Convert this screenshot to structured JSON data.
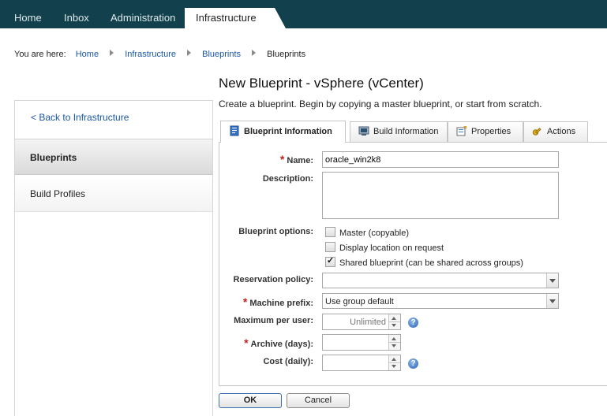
{
  "nav": {
    "tabs": [
      "Home",
      "Inbox",
      "Administration",
      "Infrastructure"
    ],
    "active": "Infrastructure"
  },
  "breadcrumb": {
    "prefix": "You are here:",
    "items": [
      "Home",
      "Infrastructure",
      "Blueprints",
      "Blueprints"
    ]
  },
  "sidebar": {
    "back_label": "< Back to Infrastructure",
    "items": [
      "Blueprints",
      "Build Profiles"
    ],
    "selected": "Blueprints"
  },
  "page": {
    "title": "New Blueprint - vSphere (vCenter)",
    "subtitle": "Create a blueprint. Begin by copying a master blueprint, or start from scratch."
  },
  "tabs": [
    {
      "label": "Blueprint Information",
      "icon": "blueprint-icon",
      "active": true
    },
    {
      "label": "Build Information",
      "icon": "server-icon",
      "active": false
    },
    {
      "label": "Properties",
      "icon": "properties-icon",
      "active": false
    },
    {
      "label": "Actions",
      "icon": "key-icon",
      "active": false
    }
  ],
  "form": {
    "name": {
      "label": "Name:",
      "value": "oracle_win2k8",
      "required": true
    },
    "description": {
      "label": "Description:",
      "value": ""
    },
    "blueprint_options": {
      "label": "Blueprint options:",
      "options": [
        {
          "label": "Master (copyable)",
          "checked": false
        },
        {
          "label": "Display location on request",
          "checked": false
        },
        {
          "label": "Shared blueprint (can be shared across groups)",
          "checked": true
        }
      ]
    },
    "reservation_policy": {
      "label": "Reservation policy:",
      "value": ""
    },
    "machine_prefix": {
      "label": "Machine prefix:",
      "value": "Use group default",
      "required": true
    },
    "maximum_per_user": {
      "label": "Maximum per user:",
      "placeholder": "Unlimited"
    },
    "archive_days": {
      "label": "Archive (days):",
      "value": "",
      "required": true
    },
    "cost_daily": {
      "label": "Cost (daily):",
      "value": ""
    }
  },
  "buttons": {
    "ok": "OK",
    "cancel": "Cancel"
  },
  "colors": {
    "nav_bg": "#12414d",
    "link": "#1a56a5",
    "required": "#c21f1f"
  }
}
